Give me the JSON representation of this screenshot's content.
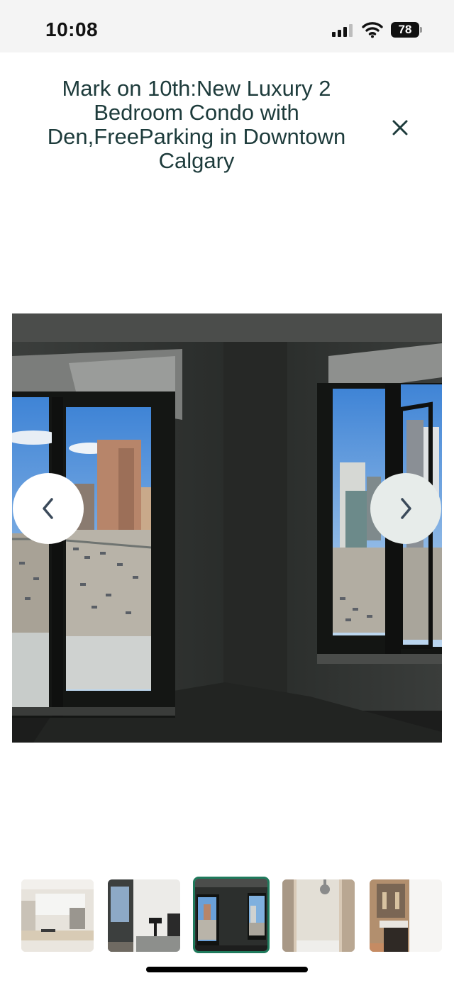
{
  "status_bar": {
    "time": "10:08",
    "battery": "78",
    "icons": [
      "cellular-signal-icon",
      "wifi-icon",
      "battery-icon"
    ]
  },
  "modal": {
    "title": "Mark on 10th:New Luxury 2 Bedroom Condo with Den,FreeParking in Downtown Calgary",
    "close_icon": "close-icon"
  },
  "gallery": {
    "prev_icon": "chevron-left-icon",
    "next_icon": "chevron-right-icon",
    "selected_index": 2,
    "thumbnails": [
      {
        "subject": "kitchen"
      },
      {
        "subject": "bedroom"
      },
      {
        "subject": "corner-windows"
      },
      {
        "subject": "shower"
      },
      {
        "subject": "bathroom"
      }
    ]
  },
  "colors": {
    "accent": "#1f7a5c",
    "title_text": "#1d3b3b",
    "status_bar_bg": "#f4f4f4"
  }
}
